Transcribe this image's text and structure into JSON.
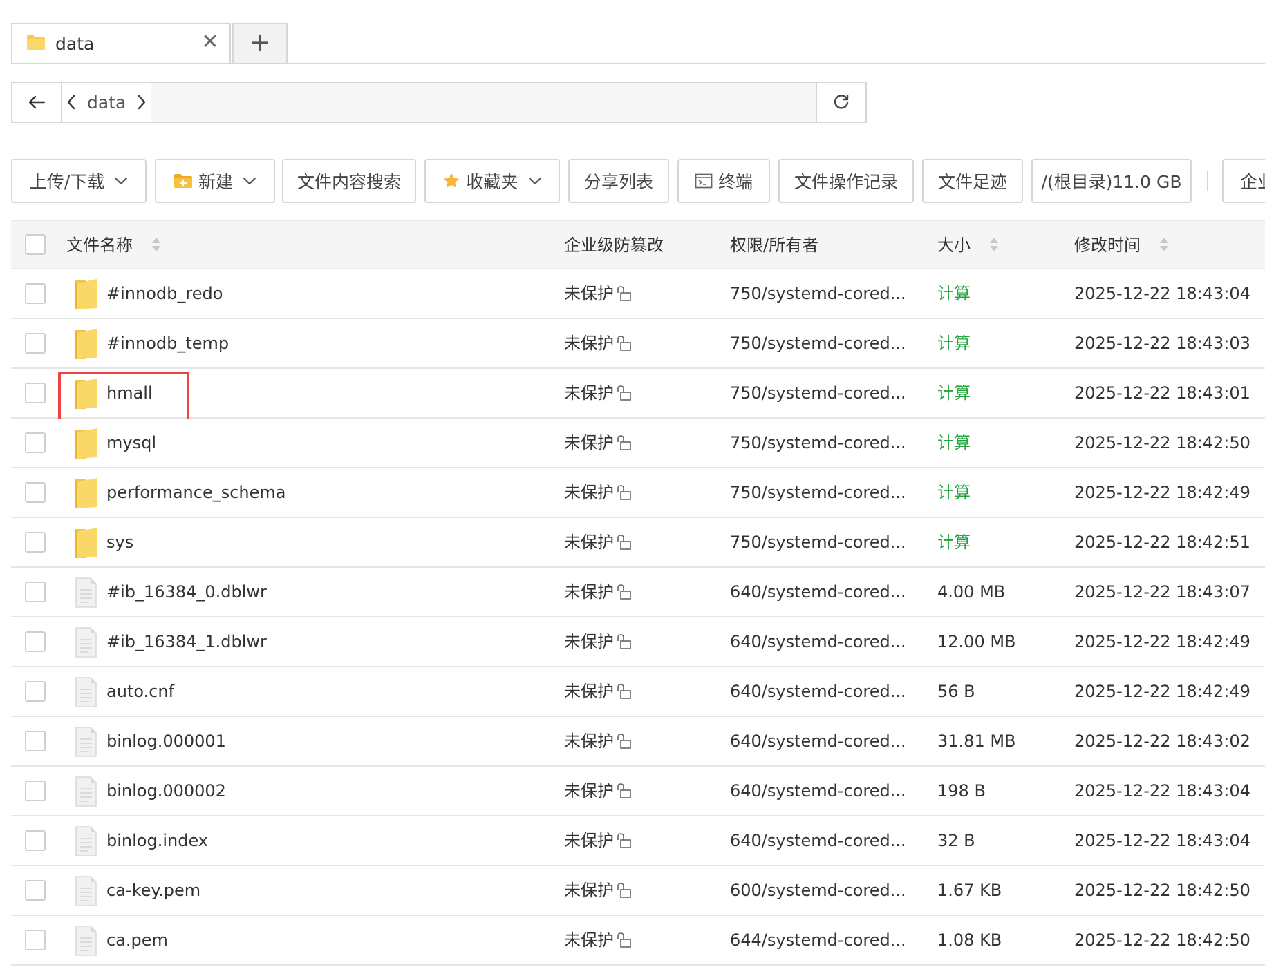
{
  "tabs": [
    {
      "label": "data",
      "close": "✕"
    }
  ],
  "tab_add": "+",
  "address": {
    "crumb": "data"
  },
  "toolbar": {
    "upload_download": "上传/下载",
    "new": "新建",
    "content_search": "文件内容搜索",
    "favorites": "收藏夹",
    "share_list": "分享列表",
    "terminal": "终端",
    "op_log": "文件操作记录",
    "footprint": "文件足迹",
    "disk_root": "/(根目录)11.0 GB",
    "enterprise_cut": "企业"
  },
  "table": {
    "headers": {
      "name": "文件名称",
      "protect": "企业级防篡改",
      "perm": "权限/所有者",
      "size": "大小",
      "mtime": "修改时间"
    },
    "rows": [
      {
        "type": "folder",
        "name": "#innodb_redo",
        "protect": "未保护",
        "perm": "750/systemd-cored...",
        "size": "计算",
        "size_is_link": true,
        "mtime": "2025-12-22 18:43:04"
      },
      {
        "type": "folder",
        "name": "#innodb_temp",
        "protect": "未保护",
        "perm": "750/systemd-cored...",
        "size": "计算",
        "size_is_link": true,
        "mtime": "2025-12-22 18:43:03"
      },
      {
        "type": "folder",
        "name": "hmall",
        "protect": "未保护",
        "perm": "750/systemd-cored...",
        "size": "计算",
        "size_is_link": true,
        "mtime": "2025-12-22 18:43:01",
        "highlighted": true
      },
      {
        "type": "folder",
        "name": "mysql",
        "protect": "未保护",
        "perm": "750/systemd-cored...",
        "size": "计算",
        "size_is_link": true,
        "mtime": "2025-12-22 18:42:50"
      },
      {
        "type": "folder",
        "name": "performance_schema",
        "protect": "未保护",
        "perm": "750/systemd-cored...",
        "size": "计算",
        "size_is_link": true,
        "mtime": "2025-12-22 18:42:49"
      },
      {
        "type": "folder",
        "name": "sys",
        "protect": "未保护",
        "perm": "750/systemd-cored...",
        "size": "计算",
        "size_is_link": true,
        "mtime": "2025-12-22 18:42:51"
      },
      {
        "type": "file",
        "name": "#ib_16384_0.dblwr",
        "protect": "未保护",
        "perm": "640/systemd-cored...",
        "size": "4.00 MB",
        "size_is_link": false,
        "mtime": "2025-12-22 18:43:07"
      },
      {
        "type": "file",
        "name": "#ib_16384_1.dblwr",
        "protect": "未保护",
        "perm": "640/systemd-cored...",
        "size": "12.00 MB",
        "size_is_link": false,
        "mtime": "2025-12-22 18:42:49"
      },
      {
        "type": "file",
        "name": "auto.cnf",
        "protect": "未保护",
        "perm": "640/systemd-cored...",
        "size": "56 B",
        "size_is_link": false,
        "mtime": "2025-12-22 18:42:49"
      },
      {
        "type": "file",
        "name": "binlog.000001",
        "protect": "未保护",
        "perm": "640/systemd-cored...",
        "size": "31.81 MB",
        "size_is_link": false,
        "mtime": "2025-12-22 18:43:02"
      },
      {
        "type": "file",
        "name": "binlog.000002",
        "protect": "未保护",
        "perm": "640/systemd-cored...",
        "size": "198 B",
        "size_is_link": false,
        "mtime": "2025-12-22 18:43:04"
      },
      {
        "type": "file",
        "name": "binlog.index",
        "protect": "未保护",
        "perm": "640/systemd-cored...",
        "size": "32 B",
        "size_is_link": false,
        "mtime": "2025-12-22 18:43:04"
      },
      {
        "type": "file",
        "name": "ca-key.pem",
        "protect": "未保护",
        "perm": "600/systemd-cored...",
        "size": "1.67 KB",
        "size_is_link": false,
        "mtime": "2025-12-22 18:42:50"
      },
      {
        "type": "file",
        "name": "ca.pem",
        "protect": "未保护",
        "perm": "644/systemd-cored...",
        "size": "1.08 KB",
        "size_is_link": false,
        "mtime": "2025-12-22 18:42:50"
      }
    ]
  },
  "colors": {
    "link_green": "#20a53a",
    "highlight_red": "#ee4444",
    "folder_yellow": "#f7cb4d",
    "border_gray": "#d6d6d6"
  },
  "icons": {
    "tab": "folder-icon",
    "back": "arrow-left-icon",
    "crumb_prev": "chevron-left-icon",
    "crumb_next": "chevron-right-icon",
    "refresh": "refresh-icon",
    "new": "new-folder-icon",
    "favorites": "star-icon",
    "terminal": "terminal-icon",
    "sort": "sort-icon",
    "lock": "unlock-icon",
    "folder_row": "folder-icon",
    "file_row": "file-icon"
  }
}
